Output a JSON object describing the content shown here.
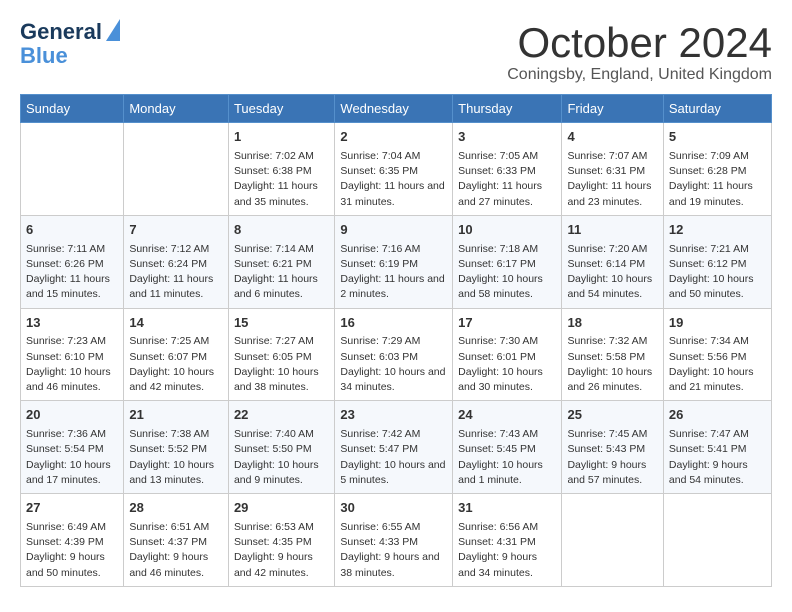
{
  "logo": {
    "line1": "General",
    "line2": "Blue"
  },
  "title": "October 2024",
  "subtitle": "Coningsby, England, United Kingdom",
  "days_of_week": [
    "Sunday",
    "Monday",
    "Tuesday",
    "Wednesday",
    "Thursday",
    "Friday",
    "Saturday"
  ],
  "weeks": [
    [
      {
        "num": "",
        "info": ""
      },
      {
        "num": "",
        "info": ""
      },
      {
        "num": "1",
        "info": "Sunrise: 7:02 AM\nSunset: 6:38 PM\nDaylight: 11 hours and 35 minutes."
      },
      {
        "num": "2",
        "info": "Sunrise: 7:04 AM\nSunset: 6:35 PM\nDaylight: 11 hours and 31 minutes."
      },
      {
        "num": "3",
        "info": "Sunrise: 7:05 AM\nSunset: 6:33 PM\nDaylight: 11 hours and 27 minutes."
      },
      {
        "num": "4",
        "info": "Sunrise: 7:07 AM\nSunset: 6:31 PM\nDaylight: 11 hours and 23 minutes."
      },
      {
        "num": "5",
        "info": "Sunrise: 7:09 AM\nSunset: 6:28 PM\nDaylight: 11 hours and 19 minutes."
      }
    ],
    [
      {
        "num": "6",
        "info": "Sunrise: 7:11 AM\nSunset: 6:26 PM\nDaylight: 11 hours and 15 minutes."
      },
      {
        "num": "7",
        "info": "Sunrise: 7:12 AM\nSunset: 6:24 PM\nDaylight: 11 hours and 11 minutes."
      },
      {
        "num": "8",
        "info": "Sunrise: 7:14 AM\nSunset: 6:21 PM\nDaylight: 11 hours and 6 minutes."
      },
      {
        "num": "9",
        "info": "Sunrise: 7:16 AM\nSunset: 6:19 PM\nDaylight: 11 hours and 2 minutes."
      },
      {
        "num": "10",
        "info": "Sunrise: 7:18 AM\nSunset: 6:17 PM\nDaylight: 10 hours and 58 minutes."
      },
      {
        "num": "11",
        "info": "Sunrise: 7:20 AM\nSunset: 6:14 PM\nDaylight: 10 hours and 54 minutes."
      },
      {
        "num": "12",
        "info": "Sunrise: 7:21 AM\nSunset: 6:12 PM\nDaylight: 10 hours and 50 minutes."
      }
    ],
    [
      {
        "num": "13",
        "info": "Sunrise: 7:23 AM\nSunset: 6:10 PM\nDaylight: 10 hours and 46 minutes."
      },
      {
        "num": "14",
        "info": "Sunrise: 7:25 AM\nSunset: 6:07 PM\nDaylight: 10 hours and 42 minutes."
      },
      {
        "num": "15",
        "info": "Sunrise: 7:27 AM\nSunset: 6:05 PM\nDaylight: 10 hours and 38 minutes."
      },
      {
        "num": "16",
        "info": "Sunrise: 7:29 AM\nSunset: 6:03 PM\nDaylight: 10 hours and 34 minutes."
      },
      {
        "num": "17",
        "info": "Sunrise: 7:30 AM\nSunset: 6:01 PM\nDaylight: 10 hours and 30 minutes."
      },
      {
        "num": "18",
        "info": "Sunrise: 7:32 AM\nSunset: 5:58 PM\nDaylight: 10 hours and 26 minutes."
      },
      {
        "num": "19",
        "info": "Sunrise: 7:34 AM\nSunset: 5:56 PM\nDaylight: 10 hours and 21 minutes."
      }
    ],
    [
      {
        "num": "20",
        "info": "Sunrise: 7:36 AM\nSunset: 5:54 PM\nDaylight: 10 hours and 17 minutes."
      },
      {
        "num": "21",
        "info": "Sunrise: 7:38 AM\nSunset: 5:52 PM\nDaylight: 10 hours and 13 minutes."
      },
      {
        "num": "22",
        "info": "Sunrise: 7:40 AM\nSunset: 5:50 PM\nDaylight: 10 hours and 9 minutes."
      },
      {
        "num": "23",
        "info": "Sunrise: 7:42 AM\nSunset: 5:47 PM\nDaylight: 10 hours and 5 minutes."
      },
      {
        "num": "24",
        "info": "Sunrise: 7:43 AM\nSunset: 5:45 PM\nDaylight: 10 hours and 1 minute."
      },
      {
        "num": "25",
        "info": "Sunrise: 7:45 AM\nSunset: 5:43 PM\nDaylight: 9 hours and 57 minutes."
      },
      {
        "num": "26",
        "info": "Sunrise: 7:47 AM\nSunset: 5:41 PM\nDaylight: 9 hours and 54 minutes."
      }
    ],
    [
      {
        "num": "27",
        "info": "Sunrise: 6:49 AM\nSunset: 4:39 PM\nDaylight: 9 hours and 50 minutes."
      },
      {
        "num": "28",
        "info": "Sunrise: 6:51 AM\nSunset: 4:37 PM\nDaylight: 9 hours and 46 minutes."
      },
      {
        "num": "29",
        "info": "Sunrise: 6:53 AM\nSunset: 4:35 PM\nDaylight: 9 hours and 42 minutes."
      },
      {
        "num": "30",
        "info": "Sunrise: 6:55 AM\nSunset: 4:33 PM\nDaylight: 9 hours and 38 minutes."
      },
      {
        "num": "31",
        "info": "Sunrise: 6:56 AM\nSunset: 4:31 PM\nDaylight: 9 hours and 34 minutes."
      },
      {
        "num": "",
        "info": ""
      },
      {
        "num": "",
        "info": ""
      }
    ]
  ]
}
